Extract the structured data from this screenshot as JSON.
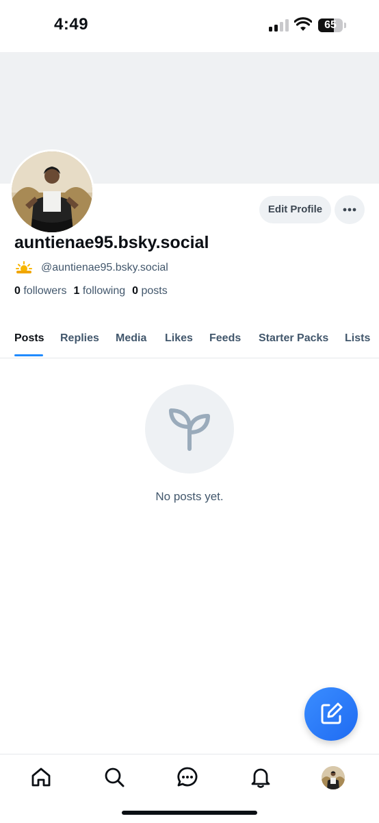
{
  "status_bar": {
    "time": "4:49",
    "battery_level": "65",
    "battery_fraction": 0.65
  },
  "profile": {
    "display_name": "auntienae95.bsky.social",
    "handle": "@auntienae95.bsky.social",
    "handle_emoji": "sun-behind-cloud-emoji",
    "edit_profile_label": "Edit Profile",
    "stats": {
      "followers_count": "0",
      "followers_label": "followers",
      "following_count": "1",
      "following_label": "following",
      "posts_count": "0",
      "posts_label": "posts"
    }
  },
  "tabs": [
    {
      "label": "Posts",
      "active": true
    },
    {
      "label": "Replies",
      "active": false
    },
    {
      "label": "Media",
      "active": false
    },
    {
      "label": "Likes",
      "active": false
    },
    {
      "label": "Feeds",
      "active": false
    },
    {
      "label": "Starter Packs",
      "active": false
    },
    {
      "label": "Lists",
      "active": false
    }
  ],
  "empty_state": {
    "message": "No posts yet.",
    "icon": "sprout-icon"
  },
  "fab": {
    "icon": "compose-icon"
  },
  "bottom_nav": [
    {
      "icon": "home-icon"
    },
    {
      "icon": "search-icon"
    },
    {
      "icon": "chat-icon"
    },
    {
      "icon": "bell-icon"
    },
    {
      "icon": "avatar"
    }
  ],
  "colors": {
    "accent": "#208bfe",
    "text_primary": "#0b0f14",
    "text_secondary": "#42576c",
    "banner_bg": "#eff1f3",
    "button_bg": "#eef1f4"
  }
}
